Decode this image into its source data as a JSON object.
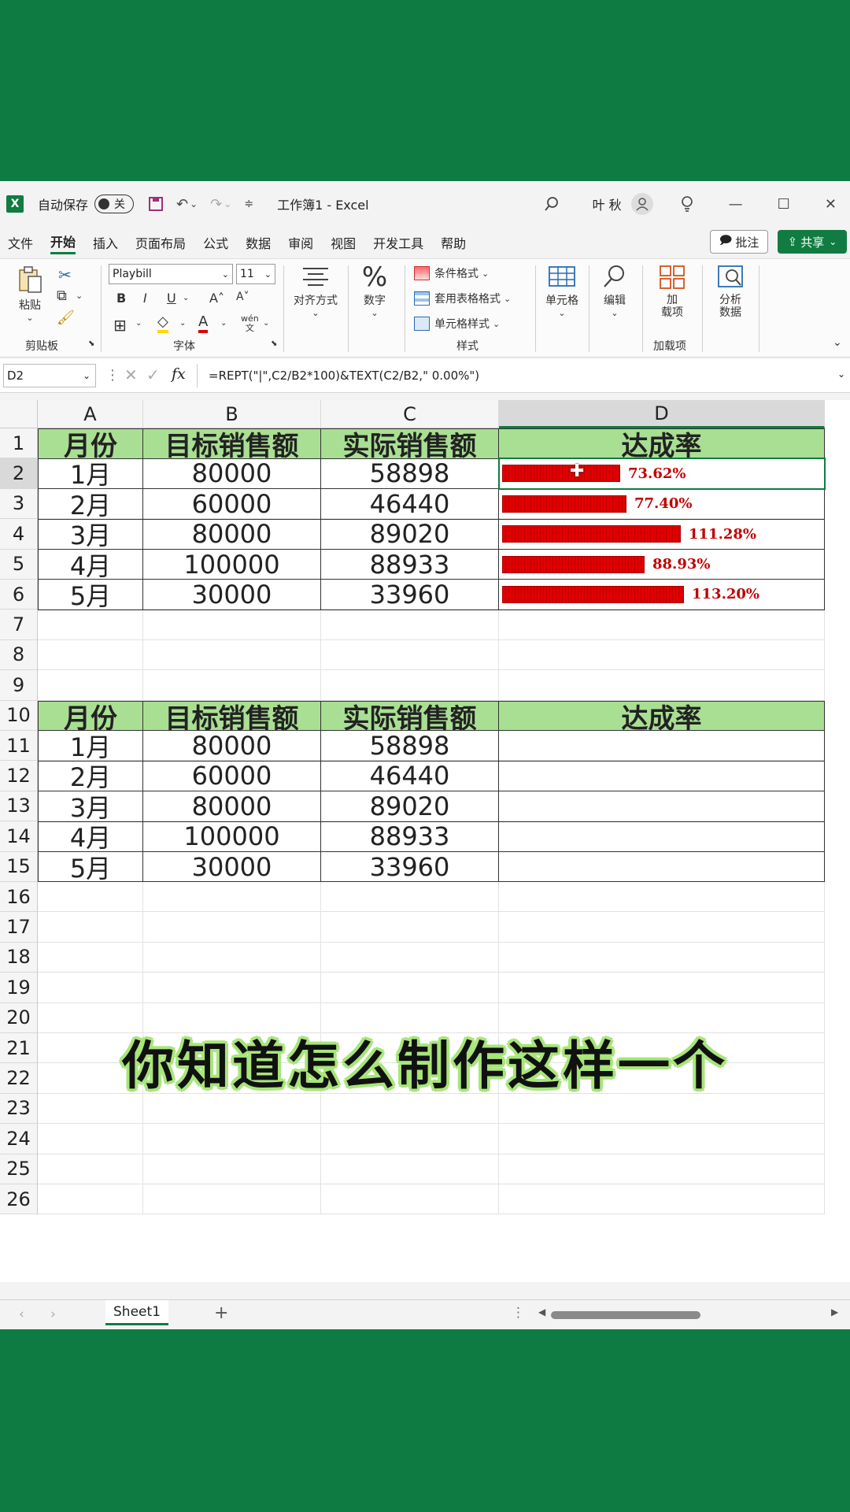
{
  "titlebar": {
    "autosave_label": "自动保存",
    "autosave_state": "关",
    "doc_title": "工作簿1  -  Excel",
    "user_name": "叶 秋"
  },
  "tabs": [
    "文件",
    "开始",
    "插入",
    "页面布局",
    "公式",
    "数据",
    "审阅",
    "视图",
    "开发工具",
    "帮助"
  ],
  "active_tab": "开始",
  "notes_button": "批注",
  "share_button": "共享",
  "ribbon": {
    "paste": "粘贴",
    "clipboard_group": "剪贴板",
    "font_name": "Playbill",
    "font_size": "11",
    "bold": "B",
    "italic": "I",
    "underline": "U",
    "grow": "A˄",
    "shrink": "A˅",
    "font_group": "字体",
    "align": "对齐方式",
    "number": "数字",
    "percent_glyph": "%",
    "cond_format": "条件格式",
    "table_format": "套用表格格式",
    "cell_style": "单元格样式",
    "styles_group": "样式",
    "cells": "单元格",
    "edit": "编辑",
    "addins_line1": "加",
    "addins_line2": "载项",
    "addins_group": "加载项",
    "analyze_line1": "分析",
    "analyze_line2": "数据"
  },
  "formula_bar": {
    "name_box": "D2",
    "fx": "fx",
    "formula": "=REPT(\"|\",C2/B2*100)&TEXT(C2/B2,\" 0.00%\")"
  },
  "columns": [
    "A",
    "B",
    "C",
    "D"
  ],
  "rows": [
    "1",
    "2",
    "3",
    "4",
    "5",
    "6",
    "7",
    "8",
    "9",
    "10",
    "11",
    "12",
    "13",
    "14",
    "15",
    "16",
    "17",
    "18",
    "19",
    "20",
    "21",
    "22",
    "23",
    "24",
    "25",
    "26"
  ],
  "table1": {
    "headers": [
      "月份",
      "目标销售额",
      "实际销售额",
      "达成率"
    ],
    "rows": [
      {
        "month": "1月",
        "target": "80000",
        "actual": "58898",
        "rate_text": "73.62%",
        "rate": 0.7362
      },
      {
        "month": "2月",
        "target": "60000",
        "actual": "46440",
        "rate_text": "77.40%",
        "rate": 0.774
      },
      {
        "month": "3月",
        "target": "80000",
        "actual": "89020",
        "rate_text": "111.28%",
        "rate": 1.1128
      },
      {
        "month": "4月",
        "target": "100000",
        "actual": "88933",
        "rate_text": "88.93%",
        "rate": 0.8893
      },
      {
        "month": "5月",
        "target": "30000",
        "actual": "33960",
        "rate_text": "113.20%",
        "rate": 1.132
      }
    ]
  },
  "table2": {
    "headers": [
      "月份",
      "目标销售额",
      "实际销售额",
      "达成率"
    ],
    "rows": [
      {
        "month": "1月",
        "target": "80000",
        "actual": "58898"
      },
      {
        "month": "2月",
        "target": "60000",
        "actual": "46440"
      },
      {
        "month": "3月",
        "target": "80000",
        "actual": "89020"
      },
      {
        "month": "4月",
        "target": "100000",
        "actual": "88933"
      },
      {
        "month": "5月",
        "target": "30000",
        "actual": "33960"
      }
    ]
  },
  "sheet_tab": "Sheet1",
  "add_sheet": "+",
  "caption": "你知道怎么制作这样一个",
  "colors": {
    "accent": "#107c41",
    "header_fill": "#a9df93",
    "bar": "#e10000",
    "bg_green": "#0e7c42"
  }
}
